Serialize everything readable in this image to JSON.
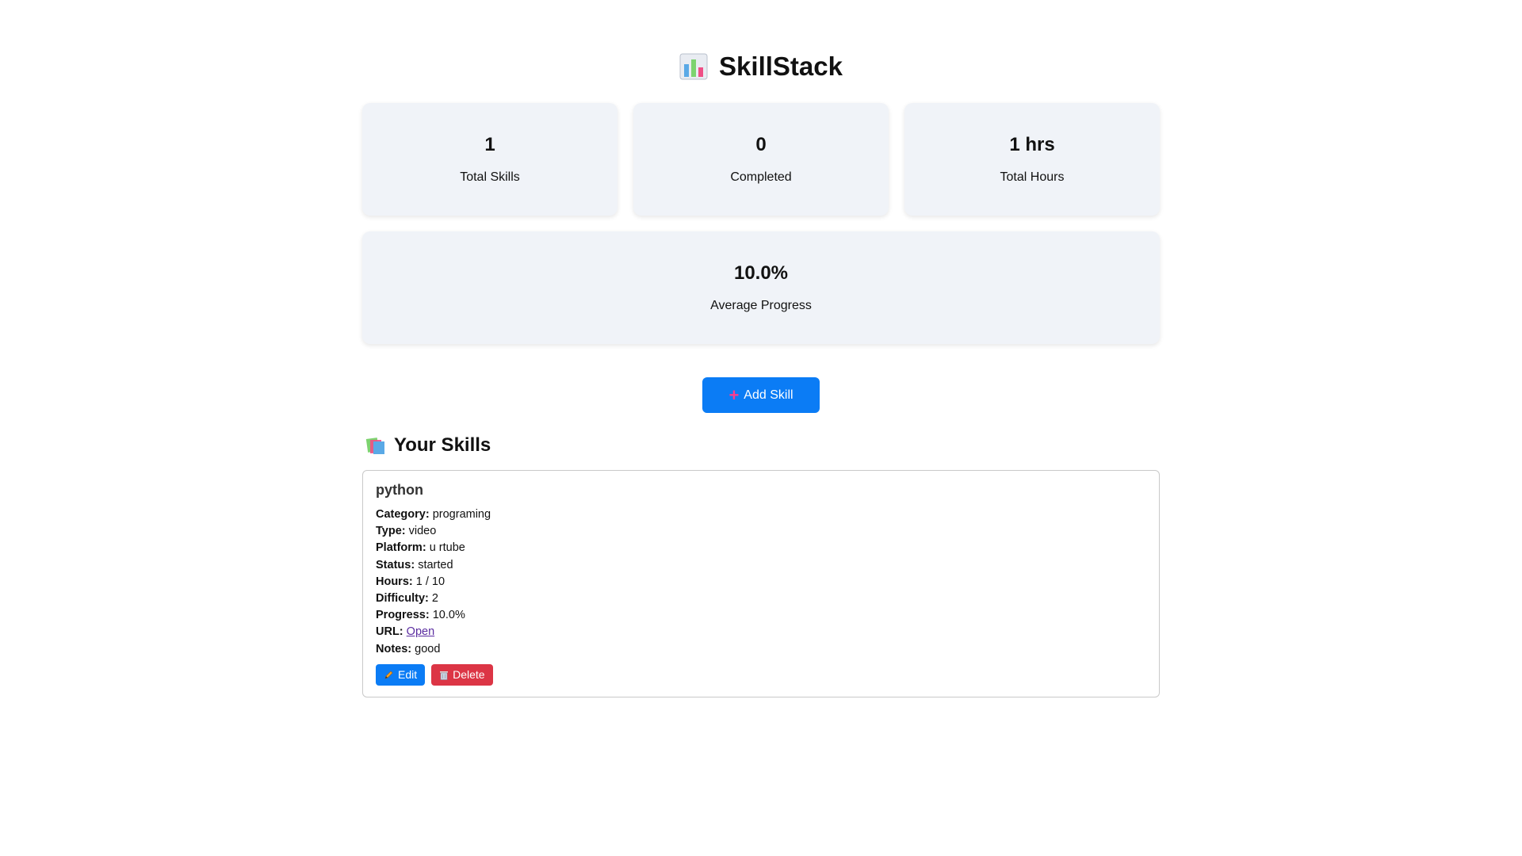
{
  "app": {
    "title": "SkillStack",
    "icon": "bar-chart-icon"
  },
  "stats": [
    {
      "value": "1",
      "label": "Total Skills"
    },
    {
      "value": "0",
      "label": "Completed"
    },
    {
      "value": "1 hrs",
      "label": "Total Hours"
    }
  ],
  "average": {
    "value": "10.0%",
    "label": "Average Progress"
  },
  "add_button": {
    "label": "Add Skill",
    "icon": "plus-icon",
    "icon_color": "#ff3b8f"
  },
  "section": {
    "title": "Your Skills",
    "icon": "books-icon"
  },
  "skills": [
    {
      "name": "python",
      "fields": {
        "category": {
          "label": "Category:",
          "value": "programing"
        },
        "type": {
          "label": "Type:",
          "value": "video"
        },
        "platform": {
          "label": "Platform:",
          "value": "u rtube"
        },
        "status": {
          "label": "Status:",
          "value": "started"
        },
        "hours": {
          "label": "Hours:",
          "value": "1 / 10"
        },
        "difficulty": {
          "label": "Difficulty:",
          "value": "2"
        },
        "progress": {
          "label": "Progress:",
          "value": "10.0%"
        },
        "url": {
          "label": "URL:",
          "link_text": "Open"
        },
        "notes": {
          "label": "Notes:",
          "value": "good"
        }
      },
      "edit_label": "Edit",
      "delete_label": "Delete"
    }
  ],
  "colors": {
    "primary": "#0b7cf5",
    "danger": "#dc3545",
    "card_bg": "#f0f3f8",
    "link": "#5a2ca0"
  }
}
